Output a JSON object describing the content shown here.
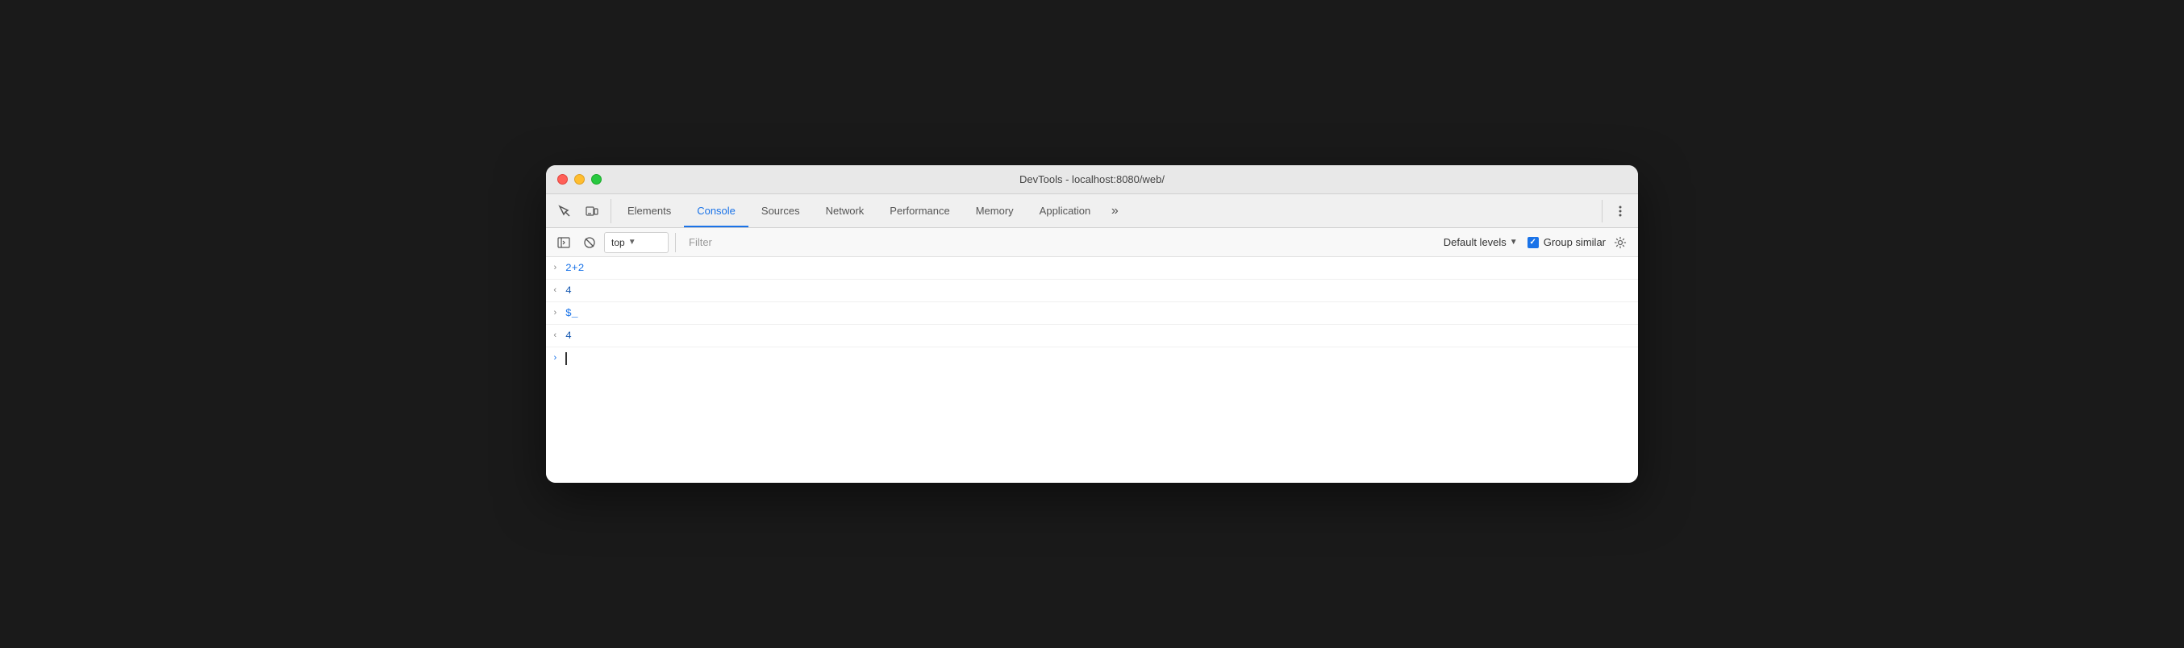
{
  "window": {
    "title": "DevTools - localhost:8080/web/"
  },
  "trafficLights": {
    "close": "close",
    "minimize": "minimize",
    "maximize": "maximize"
  },
  "tabs": [
    {
      "id": "elements",
      "label": "Elements",
      "active": false
    },
    {
      "id": "console",
      "label": "Console",
      "active": true
    },
    {
      "id": "sources",
      "label": "Sources",
      "active": false
    },
    {
      "id": "network",
      "label": "Network",
      "active": false
    },
    {
      "id": "performance",
      "label": "Performance",
      "active": false
    },
    {
      "id": "memory",
      "label": "Memory",
      "active": false
    },
    {
      "id": "application",
      "label": "Application",
      "active": false
    }
  ],
  "consoleToolbar": {
    "contextValue": "top",
    "filterPlaceholder": "Filter",
    "levelsLabel": "Default levels",
    "groupSimilarLabel": "Group similar"
  },
  "consoleEntries": [
    {
      "id": "entry1",
      "direction": ">",
      "text": "2+2",
      "color": "blue"
    },
    {
      "id": "entry2",
      "direction": "<",
      "text": "4",
      "color": "dark-blue"
    },
    {
      "id": "entry3",
      "direction": ">",
      "text": "$_",
      "color": "blue"
    },
    {
      "id": "entry4",
      "direction": "<",
      "text": "4",
      "color": "dark-blue"
    }
  ],
  "icons": {
    "cursor": "⬚",
    "layers": "⧉",
    "more": "»",
    "threeDots": "⋮",
    "sidebar": "▶|",
    "clear": "⊘",
    "gear": "⚙",
    "check": "✓"
  }
}
